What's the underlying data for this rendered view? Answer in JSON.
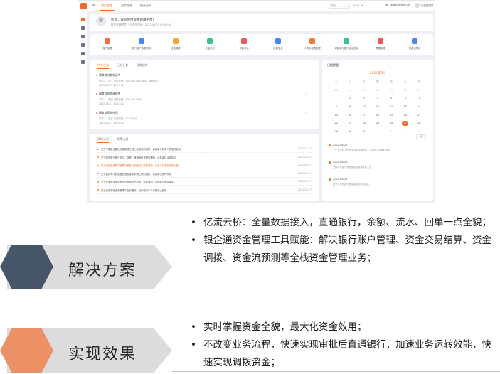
{
  "screenshot": {
    "topbar": {
      "nav": [
        "首页管理",
        "业务办理",
        "统计分析"
      ],
      "search_placeholder": "搜索",
      "icons": "◷ ☏ ✉",
      "company": "厦门某某科技有限公司",
      "user": "系统管理员"
    },
    "profile": {
      "greeting": "您好，欢迎使用资金管理平台！",
      "meta": "财务部  管理员  上次登录时间：2022-08-29 09:00:00"
    },
    "shortcuts": [
      {
        "label": "账户管理",
        "color": "#f26b4a"
      },
      {
        "label": "银行账户余额查询",
        "color": "#4a86f2"
      },
      {
        "label": "资金调拨",
        "color": "#f5a63a"
      },
      {
        "label": "资金计划",
        "color": "#3cc08a"
      },
      {
        "label": "付款申请",
        "color": "#f2555a"
      },
      {
        "label": "收款登记",
        "color": "#4a86f2"
      },
      {
        "label": "人员与权限管理",
        "color": "#f07a3a"
      },
      {
        "label": "对账单与银行流水查询",
        "color": "#3cc08a"
      },
      {
        "label": "票据管理",
        "color": "#f2555a"
      },
      {
        "label": "现金流预测",
        "color": "#4a86f2"
      }
    ],
    "tasks": {
      "tabs": [
        "待办任务",
        "已办任务",
        "我发起的"
      ],
      "items": [
        {
          "title": "请审核付款申请单",
          "line2": "申请人：张三   申请金额：100,000.00元   事由：货款支付",
          "line3": "2022-08-27  09:45:12"
        },
        {
          "title": "请审核资金调拨单",
          "line2": "申请人：李四   调拨金额：500,000.00元",
          "line3": "2022-08-27  10:15:02"
        },
        {
          "title": "请审核资金计划",
          "line2": "申请人：王五   计划周期：2022年9月",
          "line3": "2022-08-27  11:30:20"
        }
      ]
    },
    "notices": {
      "tabs": [
        "通知公告",
        "政策法规"
      ],
      "rows": [
        {
          "text": "关于开展银企直连资金管理工具上线培训的通知，请各单位财务人员准时参加",
          "date": "2022-08-27",
          "highlight": false
        },
        {
          "text": "关于规范银行账户开立、变更、撤销审批流程的通知，请各单位认真执行",
          "date": "2022-08-27",
          "highlight": false
        },
        {
          "text": "关于加强资金集中管理与资金计划编制工作的通知，请于本月底前完成上报",
          "date": "2022-08-27",
          "highlight": true
        },
        {
          "text": "关于做好年中资金盘点及现金流预测工作的通知，请各单位按时完成",
          "date": "2022-08-27",
          "highlight": false
        },
        {
          "text": "关于开展资金安全检查与网银证书更新工作的通知，请各单位配合落实",
          "date": "2022-08-27",
          "highlight": false
        },
        {
          "text": "关于启用新版资金管理平台的通知，旧系统将于下月起停止使用",
          "date": "2022-08-27",
          "highlight": false
        }
      ]
    },
    "calendar": {
      "title": "日程提醒",
      "month": "2022年8月",
      "weekdays": [
        "一",
        "二",
        "三",
        "四",
        "五",
        "六",
        "日"
      ],
      "rows": [
        [
          "25",
          "26",
          "27",
          "28",
          "29",
          "30",
          "31"
        ],
        [
          "1",
          "2",
          "3",
          "4",
          "5",
          "6",
          "7"
        ],
        [
          "8",
          "9",
          "10",
          "11",
          "12",
          "13",
          "14"
        ],
        [
          "15",
          "16",
          "17",
          "18",
          "19",
          "20",
          "21"
        ],
        [
          "22",
          "23",
          "24",
          "25",
          "26",
          "27",
          "28"
        ],
        [
          "29",
          "30",
          "31",
          "1",
          "2",
          "3",
          "4"
        ]
      ],
      "today_label": "今天",
      "events": [
        {
          "date": "2022-08-27",
          "text": "上午10:00 召开资金计划评审会议，请相关人员准时参加"
        },
        {
          "date": "2022-08-28",
          "text": "完成本月银行对账及资金余额核对工作"
        },
        {
          "date": "2022-08-29",
          "text": "提交下月资金计划及现金流预测报表"
        }
      ]
    }
  },
  "solution": {
    "label": "解决方案",
    "bullets": [
      "亿流云桥：全量数据接入，直通银行，余额、流水、回单一点全貌；",
      "银企通资金管理工具赋能：解决银行账户管理、资金交易结算、资金调拨、资金流预测等全栈资金管理业务；"
    ]
  },
  "effect": {
    "label": "实现效果",
    "bullets": [
      "实时掌握资金全貌，最大化资金效用；",
      "不改变业务流程，快速实现审批后直通银行，加速业务运转效能，快速实现调拨资金；"
    ]
  },
  "colors": {
    "accent": "#ef6a2c",
    "solution_hex": "#465567",
    "effect_hex": "#ec9066",
    "label_bar": "#dcdcdc"
  }
}
